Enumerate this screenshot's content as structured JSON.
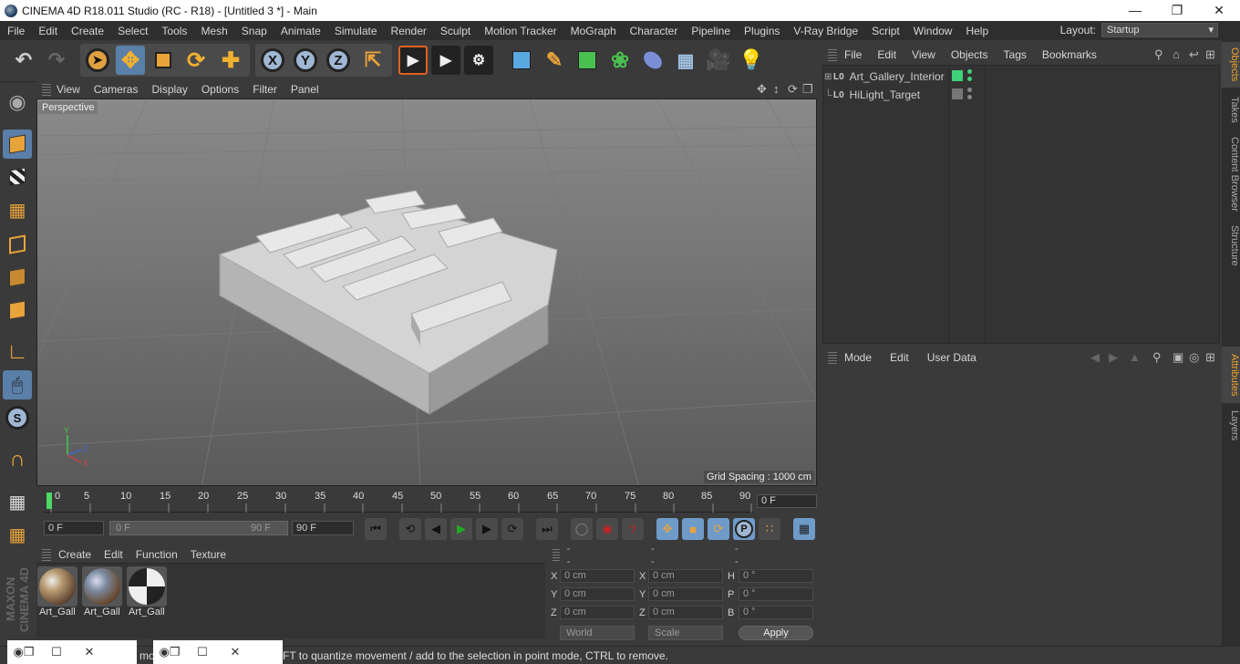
{
  "window": {
    "title": "CINEMA 4D R18.011 Studio (RC - R18) - [Untitled 3 *] - Main"
  },
  "menubar": {
    "items": [
      "File",
      "Edit",
      "Create",
      "Select",
      "Tools",
      "Mesh",
      "Snap",
      "Animate",
      "Simulate",
      "Render",
      "Sculpt",
      "Motion Tracker",
      "MoGraph",
      "Character",
      "Pipeline",
      "Plugins",
      "V-Ray Bridge",
      "Script",
      "Window",
      "Help"
    ],
    "layout_label": "Layout:",
    "layout_value": "Startup"
  },
  "viewport": {
    "menu": [
      "View",
      "Cameras",
      "Display",
      "Options",
      "Filter",
      "Panel"
    ],
    "camera_label": "Perspective",
    "grid_spacing": "Grid Spacing : 1000 cm"
  },
  "timeline": {
    "ticks": [
      "0",
      "5",
      "10",
      "15",
      "20",
      "25",
      "30",
      "35",
      "40",
      "45",
      "50",
      "55",
      "60",
      "65",
      "70",
      "75",
      "80",
      "85",
      "90"
    ],
    "current_frame": "0 F",
    "start_field": "0 F",
    "range_start": "0 F",
    "range_end": "90 F",
    "end_field": "90 F"
  },
  "materials": {
    "menu": [
      "Create",
      "Edit",
      "Function",
      "Texture"
    ],
    "items": [
      "Art_Gall",
      "Art_Gall",
      "Art_Gall"
    ]
  },
  "coordinates": {
    "headers": [
      "--",
      "--",
      "--"
    ],
    "rows": [
      {
        "l1": "X",
        "v1": "0 cm",
        "l2": "X",
        "v2": "0 cm",
        "l3": "H",
        "v3": "0 °"
      },
      {
        "l1": "Y",
        "v1": "0 cm",
        "l2": "Y",
        "v2": "0 cm",
        "l3": "P",
        "v3": "0 °"
      },
      {
        "l1": "Z",
        "v1": "0 cm",
        "l2": "Z",
        "v2": "0 cm",
        "l3": "B",
        "v3": "0 °"
      }
    ],
    "mode": "World",
    "scale": "Scale",
    "apply": "Apply"
  },
  "objects": {
    "menu": [
      "File",
      "Edit",
      "View",
      "Objects",
      "Tags",
      "Bookmarks"
    ],
    "items": [
      {
        "name": "Art_Gallery_Interior",
        "icon": "L0"
      },
      {
        "name": "HiLight_Target",
        "icon": "L0"
      }
    ]
  },
  "attributes": {
    "menu": [
      "Mode",
      "Edit",
      "User Data"
    ]
  },
  "sidetabs": [
    "Objects",
    "Takes",
    "Content Browser",
    "Structure",
    "Attributes",
    "Layers"
  ],
  "status": {
    "text": "FT to quantize movement / add to the selection in point mode, CTRL to remove.",
    "mo": "mo"
  },
  "brand": "MAXON CINEMA 4D",
  "colors": {
    "selected_tool": "#5a7fa8",
    "accent_orange": "#f0a030",
    "playhead": "#4cd964"
  }
}
